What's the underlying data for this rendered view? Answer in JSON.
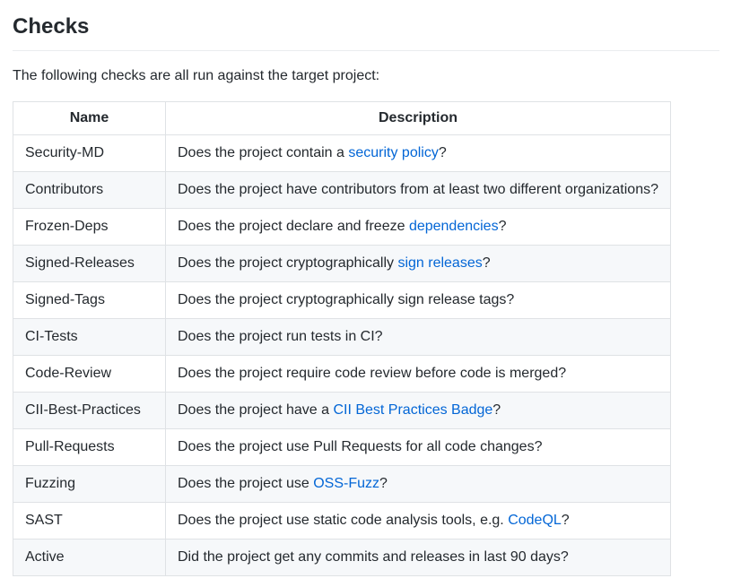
{
  "heading": "Checks",
  "intro": "The following checks are all run against the target project:",
  "table": {
    "headers": {
      "name": "Name",
      "description": "Description"
    },
    "rows": [
      {
        "name": "Security-MD",
        "desc_parts": [
          "Does the project contain a ",
          {
            "link": "security policy"
          },
          "?"
        ]
      },
      {
        "name": "Contributors",
        "desc_parts": [
          "Does the project have contributors from at least two different organizations?"
        ]
      },
      {
        "name": "Frozen-Deps",
        "desc_parts": [
          "Does the project declare and freeze ",
          {
            "link": "dependencies"
          },
          "?"
        ]
      },
      {
        "name": "Signed-Releases",
        "desc_parts": [
          "Does the project cryptographically ",
          {
            "link": "sign releases"
          },
          "?"
        ]
      },
      {
        "name": "Signed-Tags",
        "desc_parts": [
          "Does the project cryptographically sign release tags?"
        ]
      },
      {
        "name": "CI-Tests",
        "desc_parts": [
          "Does the project run tests in CI?"
        ]
      },
      {
        "name": "Code-Review",
        "desc_parts": [
          "Does the project require code review before code is merged?"
        ]
      },
      {
        "name": "CII-Best-Practices",
        "desc_parts": [
          "Does the project have a ",
          {
            "link": "CII Best Practices Badge"
          },
          "?"
        ]
      },
      {
        "name": "Pull-Requests",
        "desc_parts": [
          "Does the project use Pull Requests for all code changes?"
        ]
      },
      {
        "name": "Fuzzing",
        "desc_parts": [
          "Does the project use ",
          {
            "link": "OSS-Fuzz"
          },
          "?"
        ]
      },
      {
        "name": "SAST",
        "desc_parts": [
          "Does the project use static code analysis tools, e.g. ",
          {
            "link": "CodeQL"
          },
          "?"
        ]
      },
      {
        "name": "Active",
        "desc_parts": [
          "Did the project get any commits and releases in last 90 days?"
        ]
      }
    ]
  }
}
